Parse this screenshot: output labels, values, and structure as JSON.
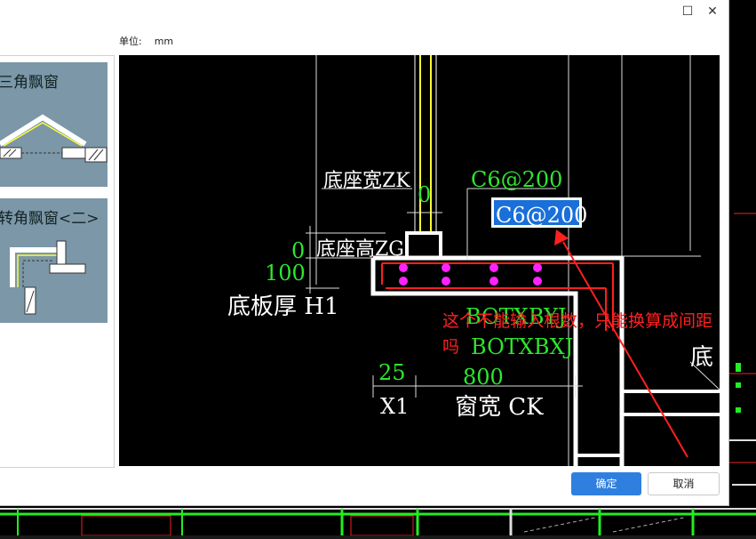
{
  "window": {
    "maximize_glyph": "☐",
    "close_glyph": "✕"
  },
  "header": {
    "unit_label": "单位:",
    "unit_value": "mm"
  },
  "sidebar": {
    "items": [
      {
        "label": "三角飘窗"
      },
      {
        "label": "转角飘窗<二>"
      }
    ]
  },
  "drawing": {
    "base_width_label": "底座宽ZK",
    "base_width_value": "0",
    "base_height_label": "底座高ZG",
    "base_height_value": "0",
    "slab_thickness_value": "100",
    "slab_thickness_label": "底板厚  H1",
    "rebar_label": "C6@200",
    "rebar_input_value": "C6@200",
    "bot_y_label": "BOTXBYJ",
    "bot_x_label": "BOTXBXJ",
    "x1_value": "25",
    "x1_label": "X1",
    "window_width_value": "800",
    "window_width_label": "窗宽 CK",
    "partial_label": "底",
    "annotation_line1": "这个不能输入根数，只能换算成间距",
    "annotation_line2": "吗"
  },
  "footer": {
    "ok_label": "确定",
    "cancel_label": "取消"
  },
  "colors": {
    "accent": "#2f7fe0",
    "cad_green": "#2ee62e",
    "cad_yellow": "#ffff33",
    "cad_magenta": "#ff22ff",
    "annotation_red": "#ff2020",
    "card_bg": "#7b97a8"
  }
}
